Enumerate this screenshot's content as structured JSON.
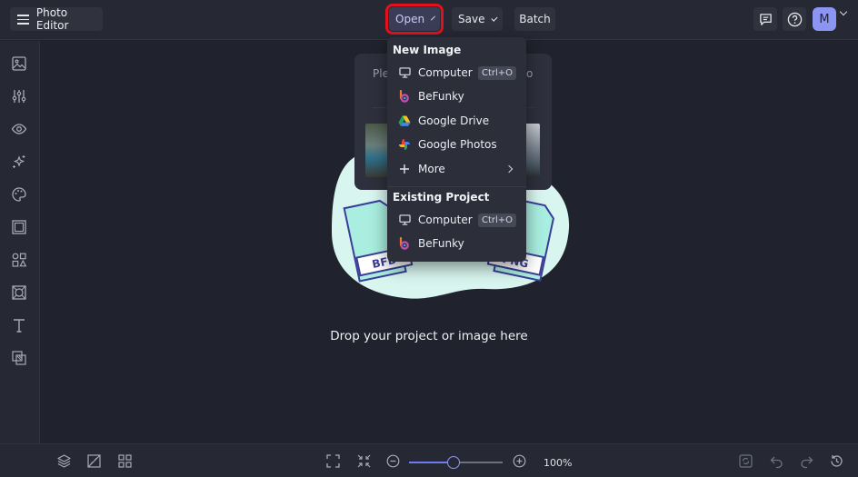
{
  "header": {
    "app_label": "Photo Editor",
    "open_label": "Open",
    "save_label": "Save",
    "batch_label": "Batch",
    "avatar_initial": "M",
    "accent": "#8c96f2",
    "highlight_color": "#e3111c"
  },
  "left_toolbar": {
    "items": [
      "image-icon",
      "sliders-icon",
      "eye-icon",
      "sparkle-icon",
      "palette-icon",
      "frame-icon",
      "shapes-icon",
      "texture-icon",
      "text-icon",
      "overlay-icon"
    ]
  },
  "canvas": {
    "drop_text": "Drop your project or image here",
    "file_badge_left": "BFD",
    "file_badge_right": "PNG",
    "blob_color": "#d8f6ef",
    "file_color": "#a9eee0",
    "file_border": "#3b3d97"
  },
  "upload_panel": {
    "text_left": "Ple",
    "text_right": "o"
  },
  "open_menu": {
    "new_image_heading": "New Image",
    "new_image_items": [
      {
        "label": "Computer",
        "shortcut": "Ctrl+O",
        "icon": "monitor-icon"
      },
      {
        "label": "BeFunky",
        "icon": "befunky-icon"
      },
      {
        "label": "Google Drive",
        "icon": "google-drive-icon"
      },
      {
        "label": "Google Photos",
        "icon": "google-photos-icon"
      },
      {
        "label": "More",
        "icon": "plus-icon"
      }
    ],
    "existing_heading": "Existing Project",
    "existing_items": [
      {
        "label": "Computer",
        "shortcut": "Ctrl+O",
        "icon": "monitor-icon"
      },
      {
        "label": "BeFunky",
        "icon": "befunky-icon"
      }
    ]
  },
  "bottom_bar": {
    "zoom_text": "100%",
    "zoom_fraction": 0.48
  }
}
